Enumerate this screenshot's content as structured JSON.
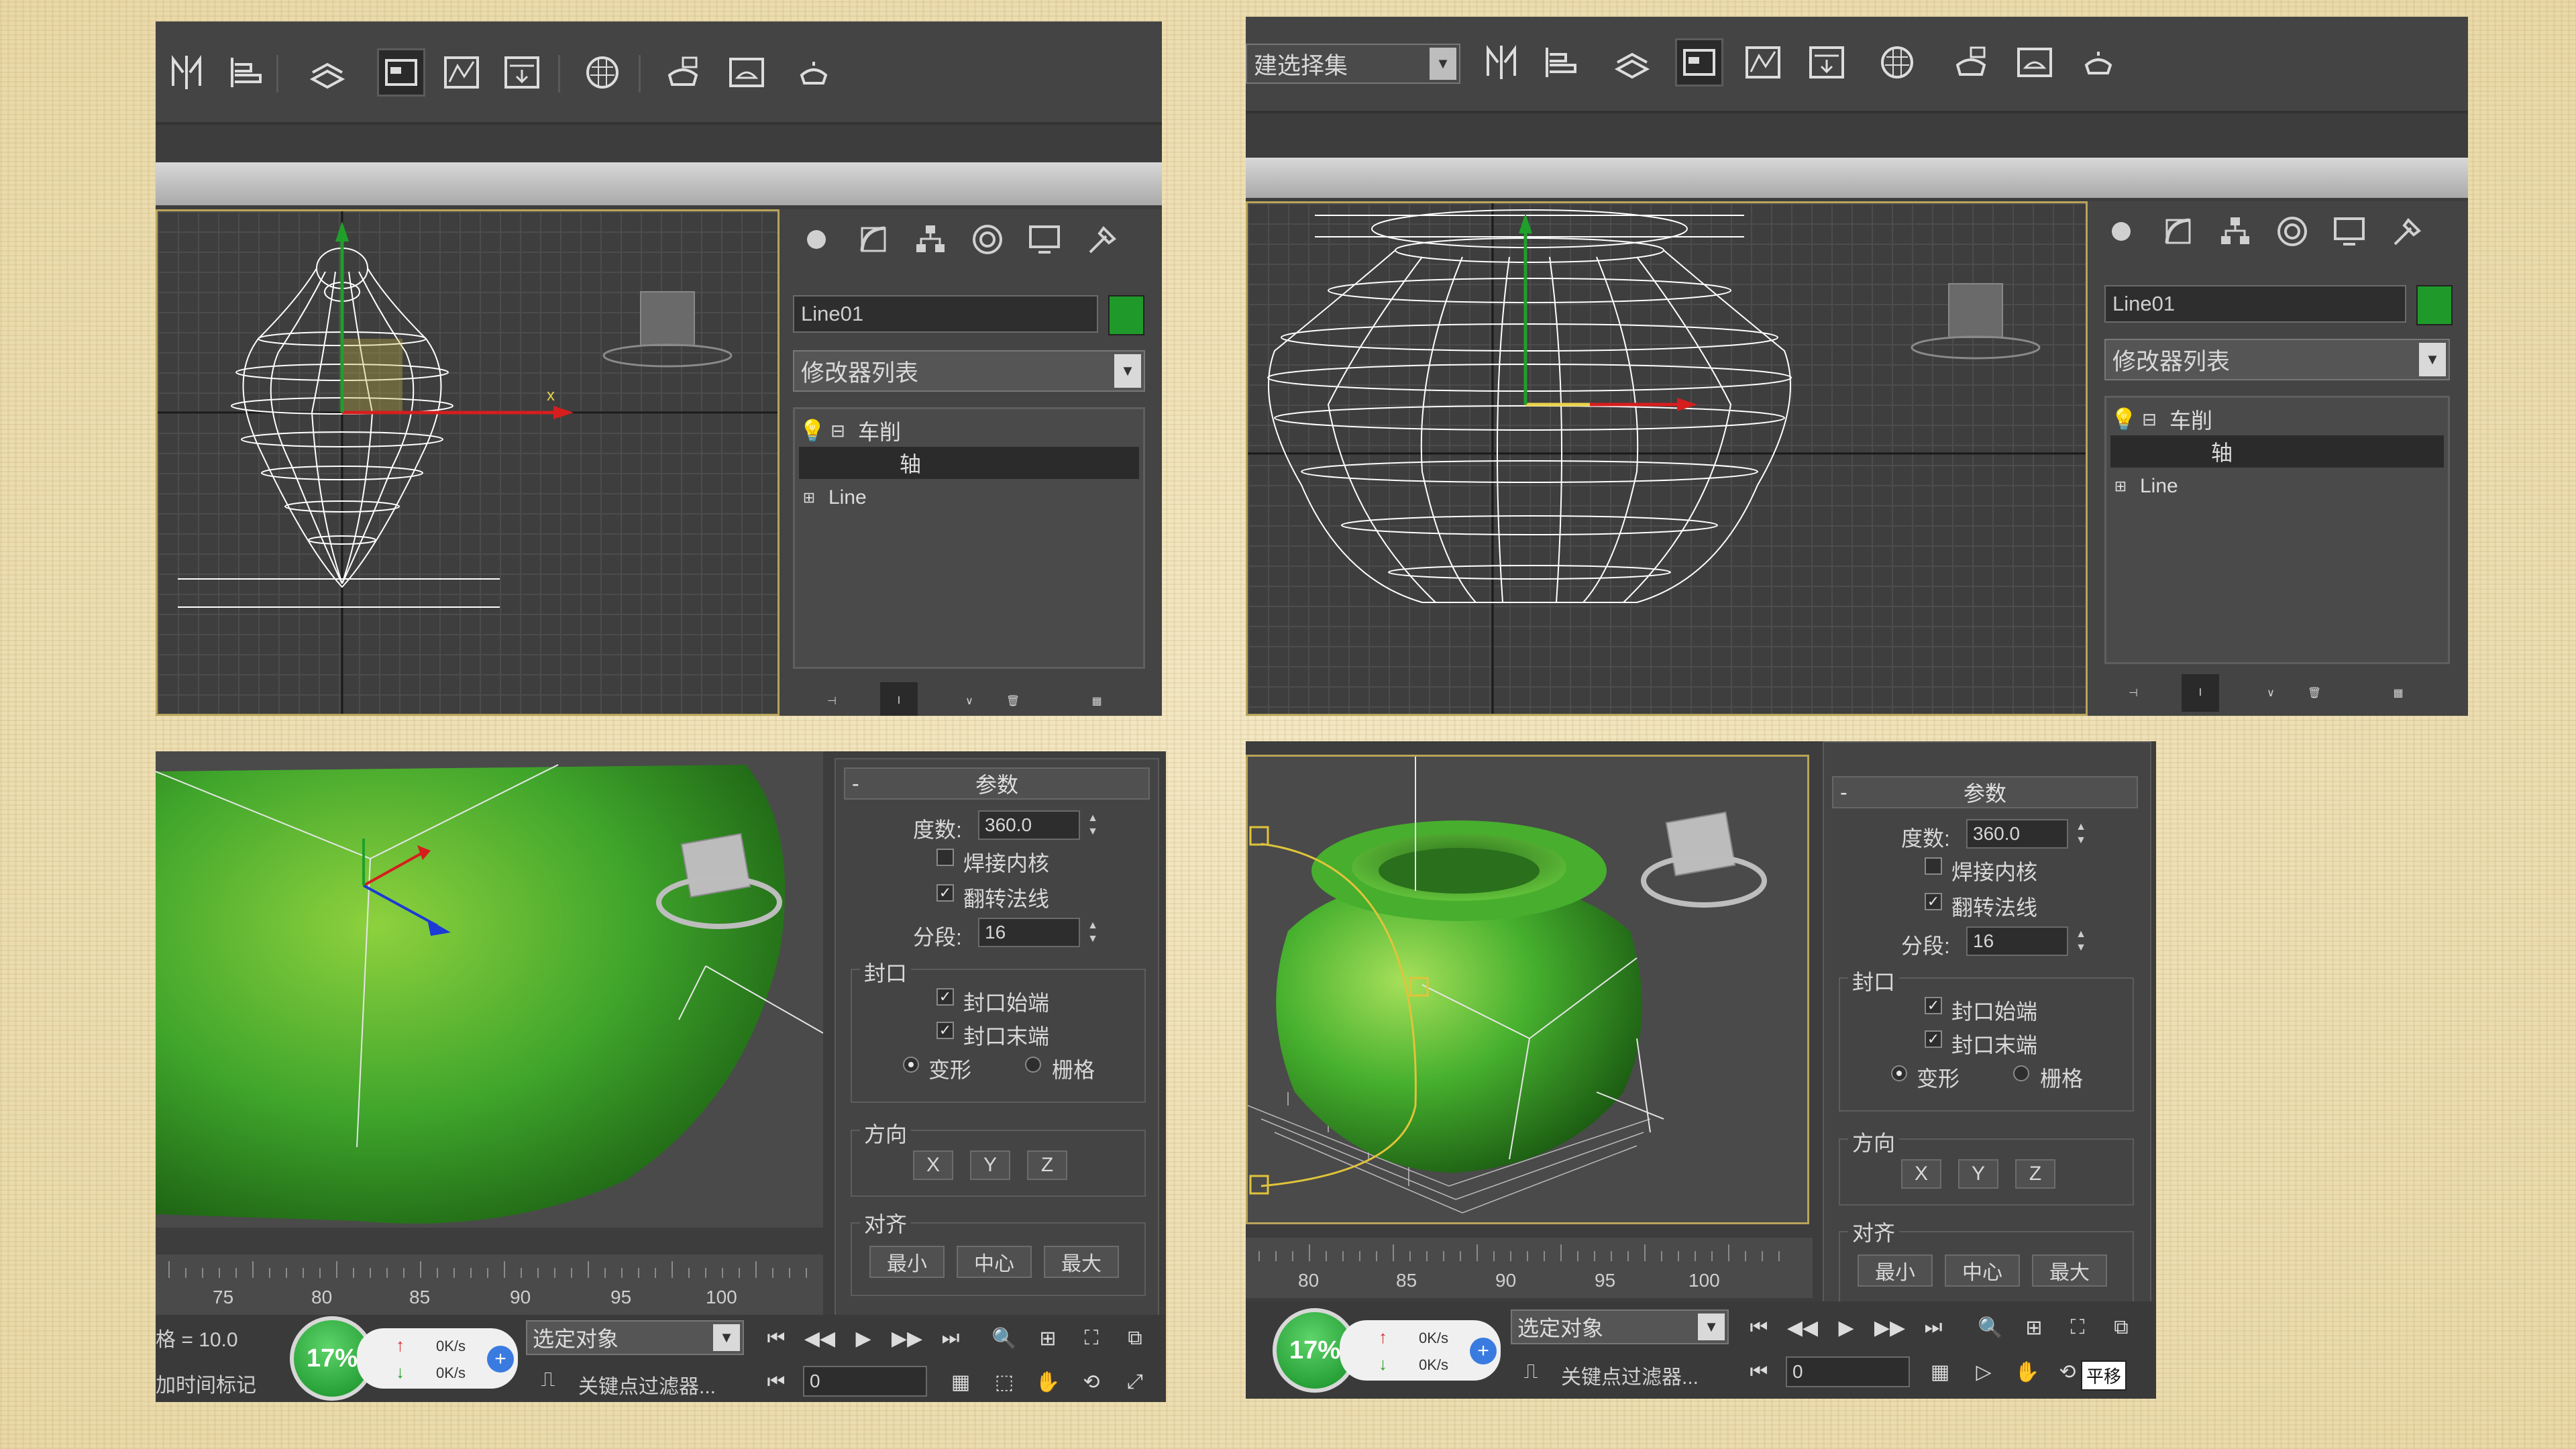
{
  "panels": {
    "top_left": {
      "object_name": "Line01",
      "modifier_list": "修改器列表",
      "stack": {
        "modifier": "车削",
        "sub": "轴",
        "base": "Line"
      },
      "axis_label": "x"
    },
    "top_right": {
      "selection_set": "建选择集",
      "object_name": "Line01",
      "modifier_list": "修改器列表",
      "stack": {
        "modifier": "车削",
        "sub": "轴",
        "base": "Line"
      }
    },
    "bottom_left": {
      "params": {
        "title": "参数",
        "degrees_label": "度数:",
        "degrees_value": "360.0",
        "weld_core": "焊接内核",
        "flip_normals": "翻转法线",
        "segments_label": "分段:",
        "segments_value": "16",
        "capping": "封口",
        "cap_start": "封口始端",
        "cap_end": "封口末端",
        "morph": "变形",
        "grid": "栅格",
        "direction": "方向",
        "x": "X",
        "y": "Y",
        "z": "Z",
        "align": "对齐",
        "min": "最小",
        "center": "中心",
        "max": "最大"
      },
      "timeline_ticks": [
        "75",
        "80",
        "85",
        "90",
        "95",
        "100"
      ],
      "status": {
        "grid_text": "格 = 10.0",
        "add_time_tag": "加时间标记",
        "percent": "17%",
        "up_rate": "0K/s",
        "down_rate": "0K/s",
        "selected_object": "选定对象",
        "key_filter": "关键点过滤器...",
        "frame": "0"
      }
    },
    "bottom_right": {
      "params": {
        "title": "参数",
        "degrees_label": "度数:",
        "degrees_value": "360.0",
        "weld_core": "焊接内核",
        "flip_normals": "翻转法线",
        "segments_label": "分段:",
        "segments_value": "16",
        "capping": "封口",
        "cap_start": "封口始端",
        "cap_end": "封口末端",
        "morph": "变形",
        "grid": "栅格",
        "direction": "方向",
        "x": "X",
        "y": "Y",
        "z": "Z",
        "align": "对齐",
        "min": "最小",
        "center": "中心",
        "max": "最大"
      },
      "timeline_ticks": [
        "80",
        "85",
        "90",
        "95",
        "100"
      ],
      "status": {
        "percent": "17%",
        "up_rate": "0K/s",
        "down_rate": "0K/s",
        "selected_object": "选定对象",
        "key_filter": "关键点过滤器...",
        "frame": "0",
        "pan_tooltip": "平移"
      }
    }
  },
  "colors": {
    "background": "#efe3b8",
    "object_color": "#1f9a2a",
    "model_green": "#3fa52b",
    "wire": "#ffffff",
    "accent_yellow": "#b8a45a"
  }
}
